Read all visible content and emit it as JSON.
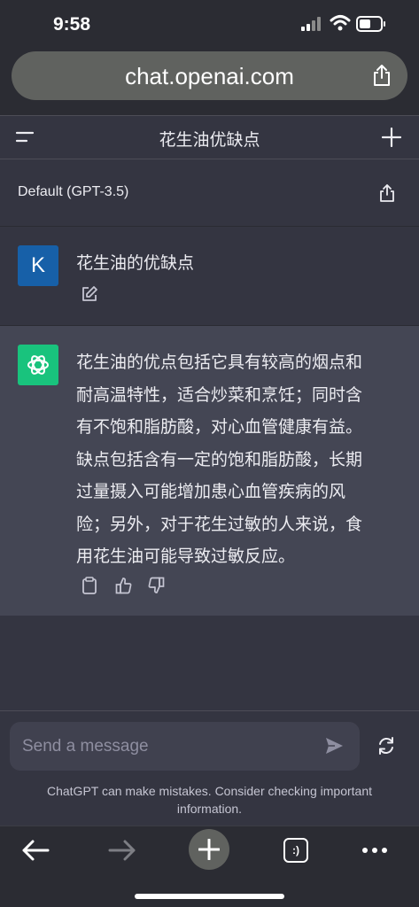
{
  "status_bar": {
    "time": "9:58"
  },
  "browser": {
    "url": "chat.openai.com"
  },
  "header": {
    "title": "花生油优缺点"
  },
  "model": {
    "label": "Default (GPT-3.5)"
  },
  "user_message": {
    "avatar_letter": "K",
    "text": "花生油的优缺点"
  },
  "assistant_message": {
    "lines": [
      "花生油的优点包括它具有较高的烟点和",
      "耐高温特性，适合炒菜和烹饪；同时含",
      "有不饱和脂肪酸，对心血管健康有益。",
      "缺点包括含有一定的饱和脂肪酸，长期",
      "过量摄入可能增加患心血管疾病的风",
      "险；另外，对于花生过敏的人来说，食",
      "用花生油可能导致过敏反应。"
    ]
  },
  "composer": {
    "placeholder": "Send a message",
    "disclaimer": "ChatGPT can make mistakes. Consider checking important information."
  },
  "bottom_bar": {
    "tabs_label": ":)"
  },
  "icons": {
    "menu": "menu-icon",
    "new_chat": "plus-icon",
    "share": "share-icon",
    "edit": "edit-icon",
    "copy": "clipboard-icon",
    "thumbs_up": "thumbs-up-icon",
    "thumbs_down": "thumbs-down-icon",
    "send": "send-icon",
    "regenerate": "refresh-icon",
    "back": "arrow-left-icon",
    "forward": "arrow-right-icon",
    "more": "more-icon"
  },
  "colors": {
    "background": "#343541",
    "assistant_bg": "#444654",
    "user_avatar": "#1760a8",
    "bot_avatar": "#19c37d",
    "composer_bg": "#40414f",
    "browser_chrome": "#2b2c33"
  }
}
